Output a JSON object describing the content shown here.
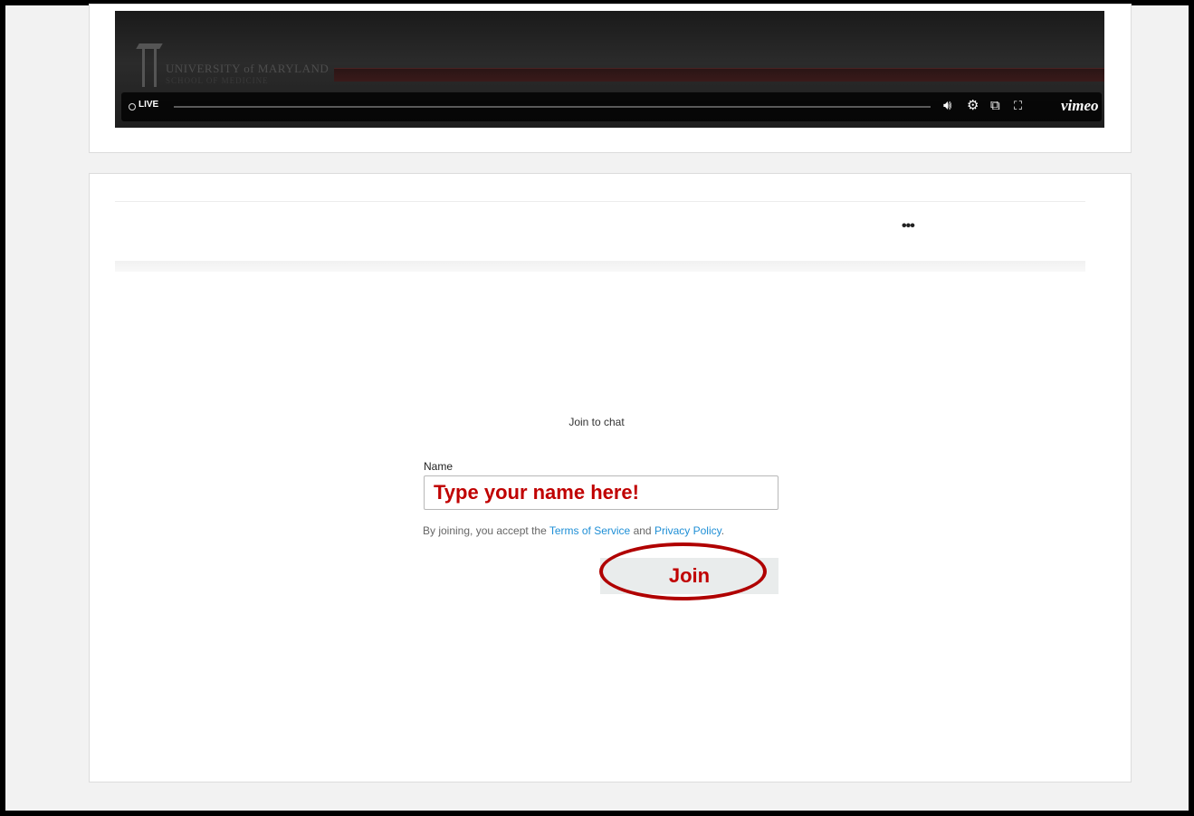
{
  "video": {
    "logo_text": "UNIVERSITY of MARYLAND",
    "logo_sub": "SCHOOL OF MEDICINE",
    "live_label": "LIVE",
    "brand": "vimeo",
    "icons": [
      "volume-icon",
      "settings-gear-icon",
      "picture-in-picture-icon",
      "fullscreen-icon"
    ]
  },
  "chat": {
    "more_label": "•••",
    "join_title": "Join to chat",
    "name_label": "Name",
    "name_placeholder": "Type your name here!",
    "terms_prefix": "By joining, you accept the ",
    "terms_link": "Terms of Service",
    "terms_middle": " and ",
    "privacy_link": "Privacy Policy",
    "terms_suffix": ".",
    "join_button": "Join"
  },
  "colors": {
    "annotation_red": "#c00000",
    "link_blue": "#1f8fd6"
  }
}
